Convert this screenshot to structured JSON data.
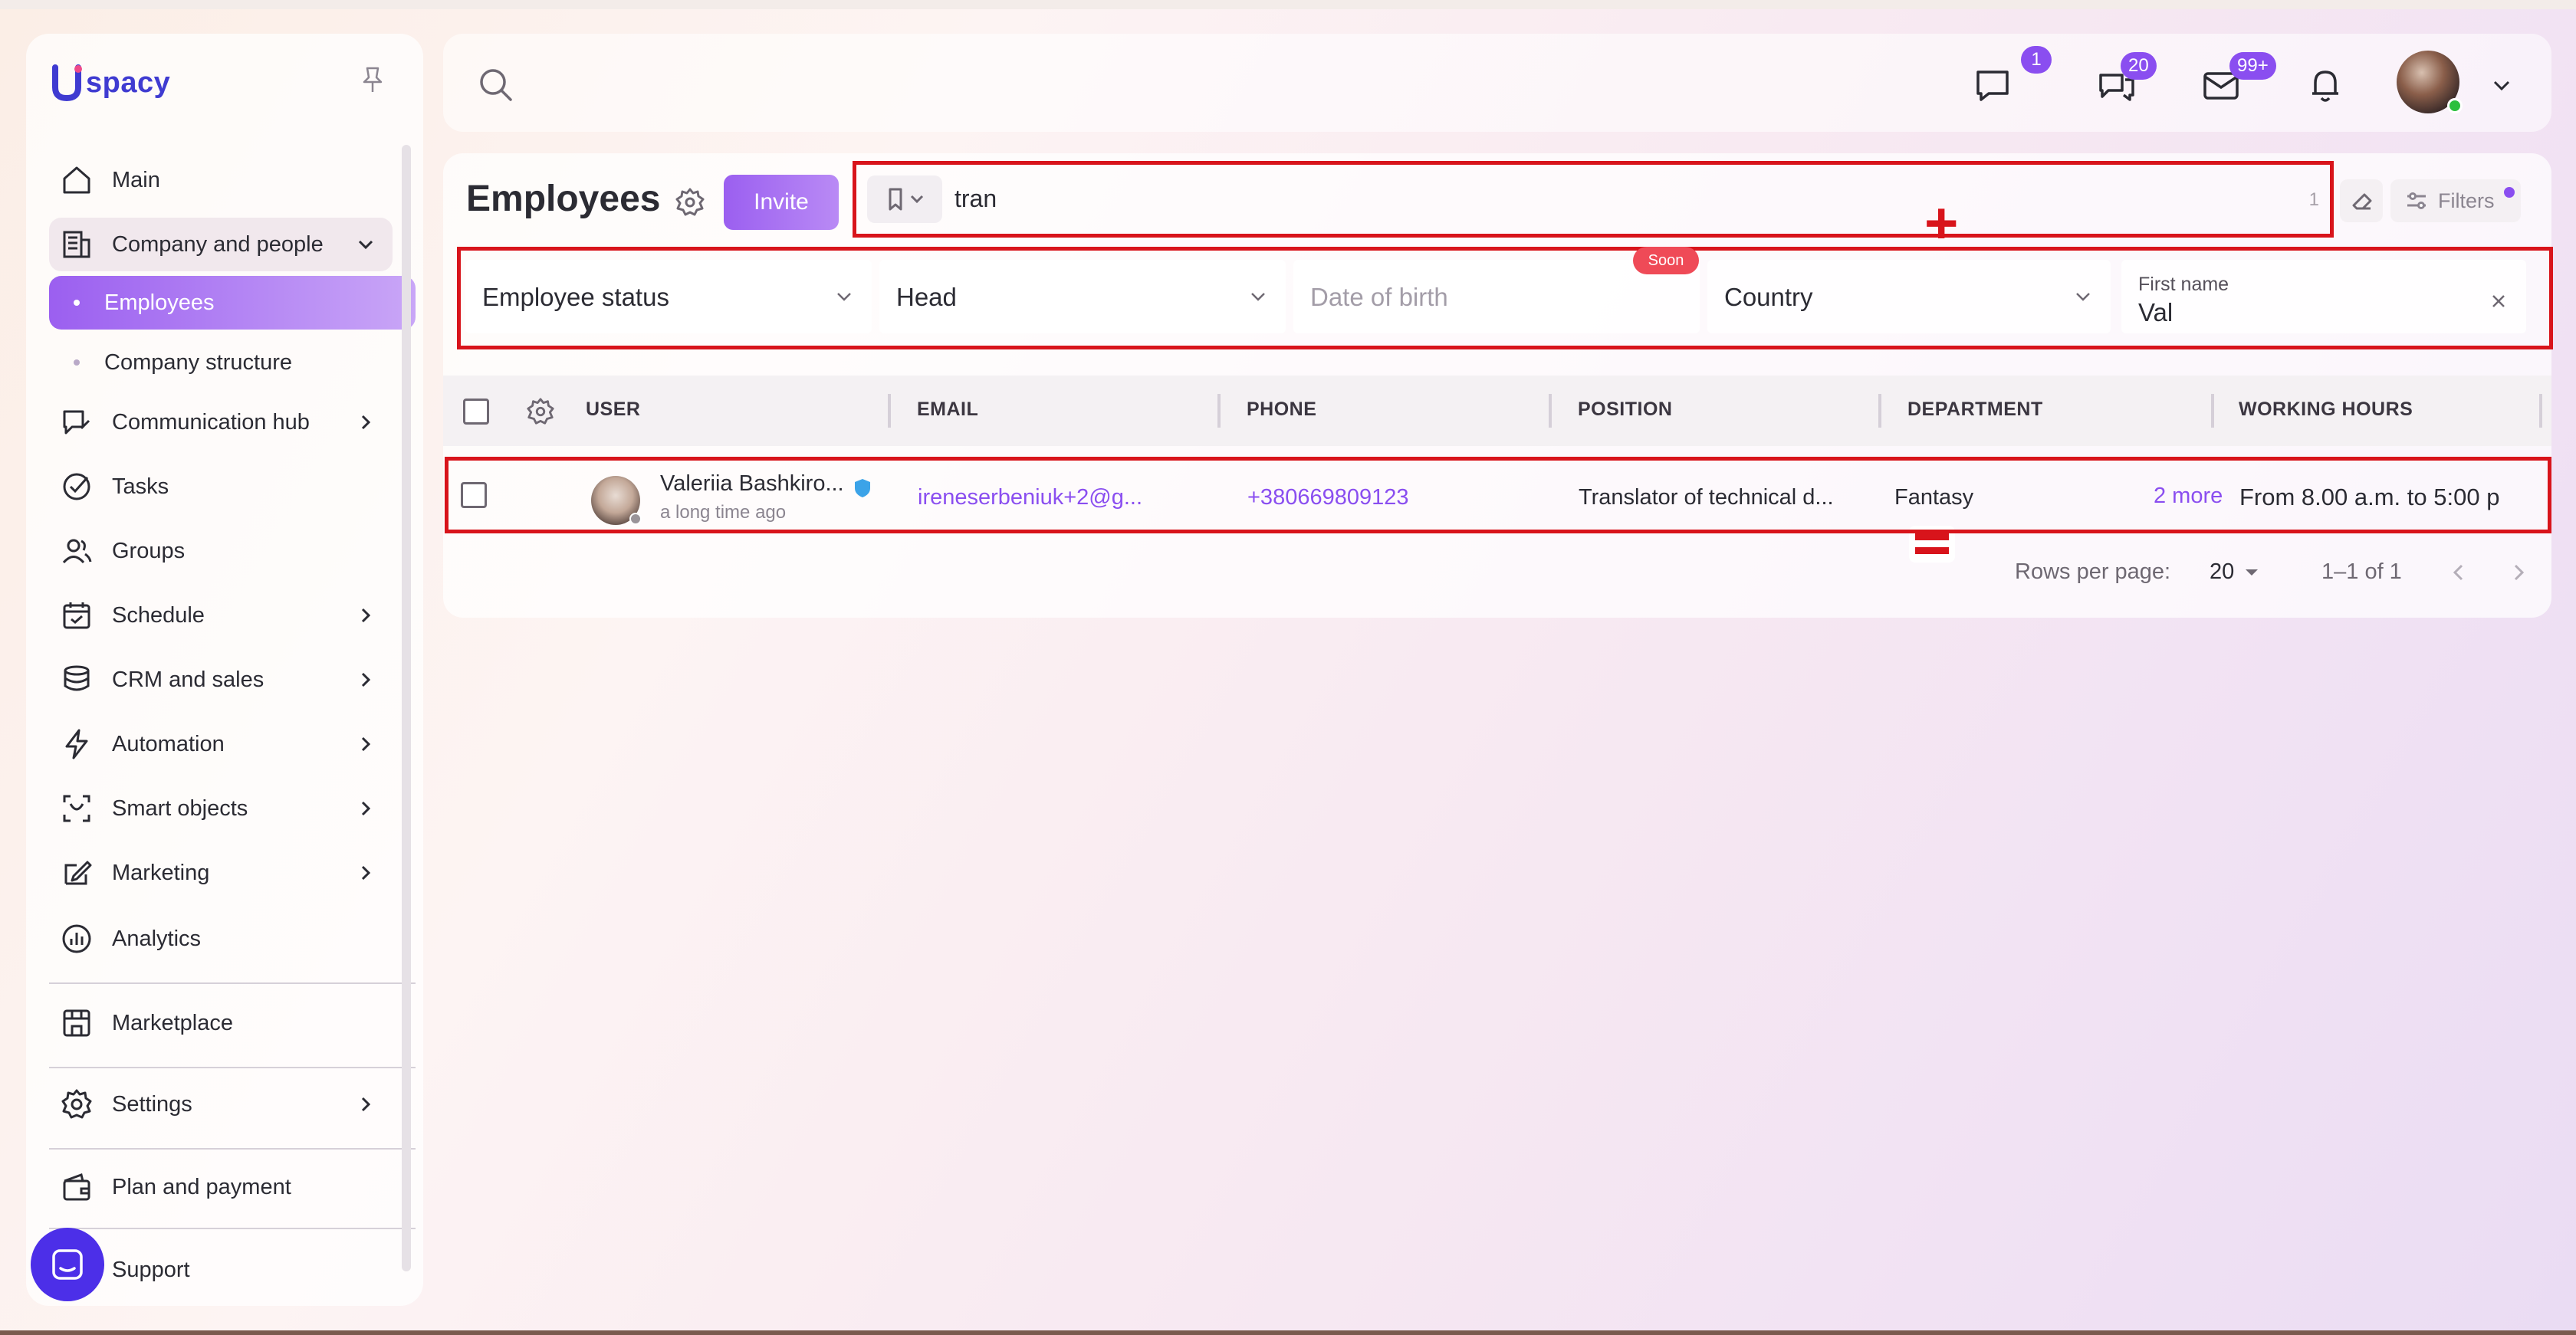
{
  "app": {
    "logo_text": "spacy"
  },
  "sidebar": {
    "items": [
      {
        "label": "Main",
        "icon": "home-icon"
      },
      {
        "label": "Company and people",
        "icon": "building-icon"
      },
      {
        "label": "Employees"
      },
      {
        "label": "Company structure"
      },
      {
        "label": "Communication hub",
        "icon": "chat-edit-icon"
      },
      {
        "label": "Tasks",
        "icon": "check-circle-icon"
      },
      {
        "label": "Groups",
        "icon": "users-icon"
      },
      {
        "label": "Schedule",
        "icon": "calendar-icon"
      },
      {
        "label": "CRM and sales",
        "icon": "coins-icon"
      },
      {
        "label": "Automation",
        "icon": "lightning-icon"
      },
      {
        "label": "Smart objects",
        "icon": "scan-icon"
      },
      {
        "label": "Marketing",
        "icon": "marketing-icon"
      },
      {
        "label": "Analytics",
        "icon": "analytics-icon"
      },
      {
        "label": "Marketplace",
        "icon": "store-icon"
      },
      {
        "label": "Settings",
        "icon": "gear-icon"
      },
      {
        "label": "Plan and payment",
        "icon": "wallet-icon"
      },
      {
        "label": "Support",
        "icon": "support-icon"
      }
    ]
  },
  "topbar": {
    "badges": {
      "messages": "1",
      "chats": "20",
      "mail": "99+"
    }
  },
  "page": {
    "title": "Employees",
    "invite_label": "Invite",
    "search_value": "tran",
    "search_count": "1",
    "filters_label": "Filters"
  },
  "filters": {
    "employee_status": "Employee status",
    "head": "Head",
    "date_of_birth": "Date of birth",
    "soon_badge": "Soon",
    "country": "Country",
    "first_name_label": "First name",
    "first_name_value": "Val"
  },
  "table": {
    "headers": [
      "USER",
      "EMAIL",
      "PHONE",
      "POSITION",
      "DEPARTMENT",
      "WORKING HOURS"
    ],
    "rows": [
      {
        "name": "Valeriia Bashkiro...",
        "last_seen": "a long time ago",
        "email": "ireneserbeniuk+2@g...",
        "phone": "+380669809123",
        "position": "Translator of technical d...",
        "department": "Fantasy",
        "more": "2 more",
        "hours": "From 8.00 a.m. to 5:00 p"
      }
    ]
  },
  "pagination": {
    "rows_per_page_label": "Rows per page:",
    "rows_per_page_value": "20",
    "range": "1–1 of 1"
  },
  "colors": {
    "accent": "#8a4ef0",
    "highlight_red": "#d8141b"
  }
}
